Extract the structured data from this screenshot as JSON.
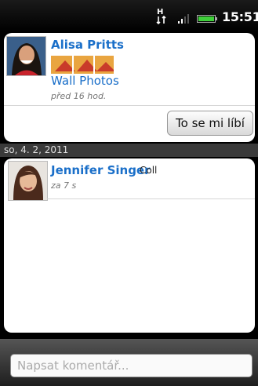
{
  "status_bar": {
    "time": "15:51",
    "icons": [
      "network-activity-icon",
      "signal-icon",
      "battery-icon"
    ]
  },
  "post": {
    "author": "Alisa Pritts",
    "link": "Wall Photos",
    "timestamp": "před 16 hod.",
    "like_button": "To se mi líbí"
  },
  "date_header": "so, 4. 2, 2011",
  "comment": {
    "author": "Jennifer Singer",
    "text": "Coll",
    "timestamp": "za 7 s"
  },
  "comment_bar": {
    "placeholder": "Napsat komentář..."
  },
  "colors": {
    "link_blue": "#1a6fc9",
    "background": "#000000",
    "card": "#ffffff"
  }
}
